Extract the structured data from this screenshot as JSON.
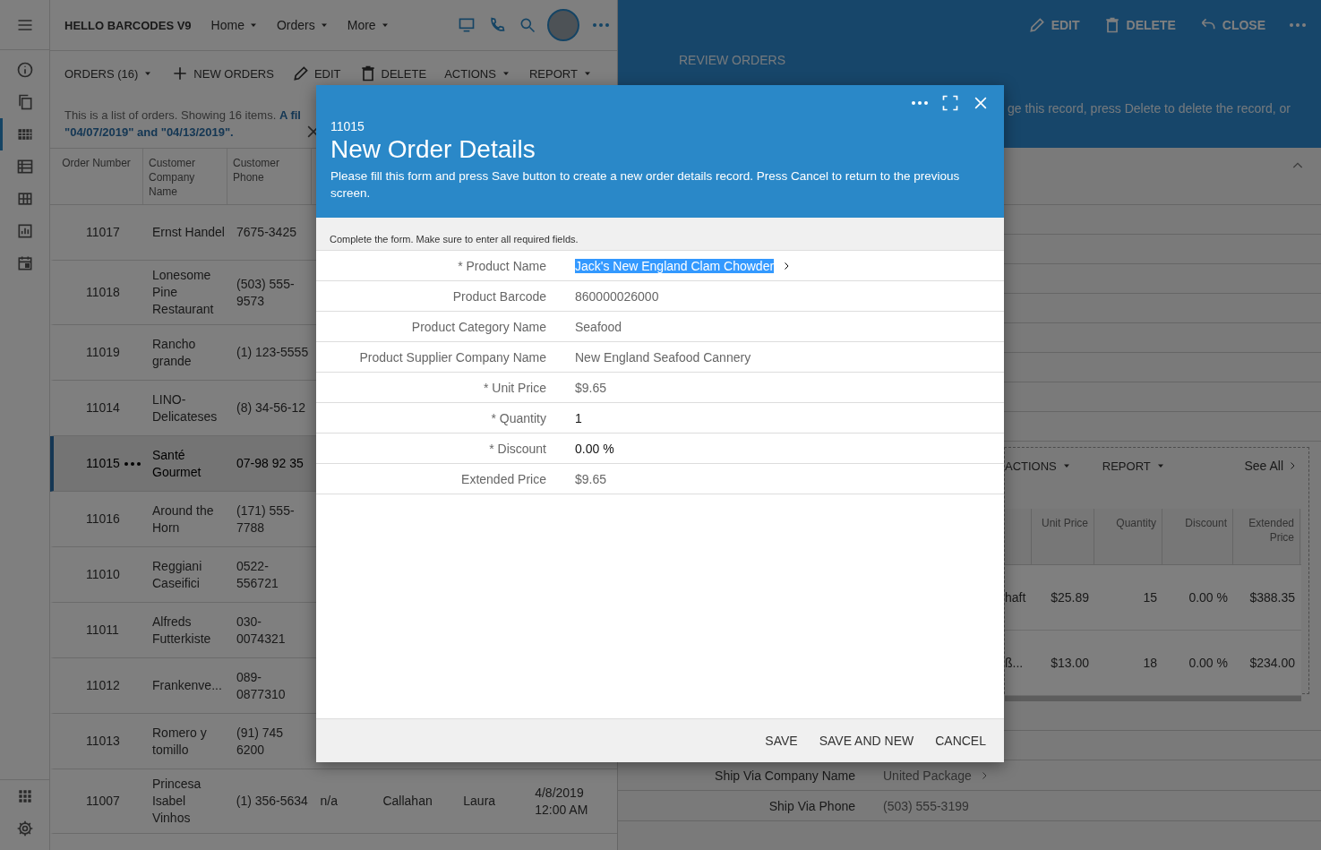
{
  "rail": {
    "top": [
      {
        "selected": false
      },
      {
        "selected": false
      },
      {
        "selected": true
      },
      {
        "selected": false
      },
      {
        "selected": false
      },
      {
        "selected": false
      },
      {
        "selected": false
      }
    ],
    "bottom": [
      {
        "selected": false
      },
      {
        "selected": false
      }
    ]
  },
  "app_bar": {
    "brand": "HELLO BARCODES V9",
    "menus": [
      "Home",
      "Orders",
      "More"
    ]
  },
  "list_toolbar": [
    {
      "kind": "dropdown",
      "label": "ORDERS (16)"
    },
    {
      "kind": "add",
      "label": "NEW ORDERS"
    },
    {
      "kind": "edit",
      "label": "EDIT"
    },
    {
      "kind": "delete",
      "label": "DELETE"
    },
    {
      "kind": "dropdown",
      "label": "ACTIONS"
    },
    {
      "kind": "dropdown",
      "label": "REPORT"
    }
  ],
  "filter": {
    "text": "This is a list of orders. Showing 16 items.",
    "link_start": "A fil",
    "link_end": "\"04/07/2019\" and \"04/13/2019\"."
  },
  "table": {
    "columns": [
      "Order Number",
      "Customer Company Name",
      "Customer Phone"
    ],
    "rows": [
      {
        "selected": false,
        "cells": [
          "11017",
          "Ernst Handel",
          "7675-3425"
        ]
      },
      {
        "selected": false,
        "cells": [
          "11018",
          "Lonesome Pine Restaurant",
          "(503) 555-9573"
        ]
      },
      {
        "selected": false,
        "cells": [
          "11019",
          "Rancho grande",
          "(1) 123-5555"
        ]
      },
      {
        "selected": false,
        "cells": [
          "11014",
          "LINO-Delicateses",
          "(8) 34-56-12"
        ]
      },
      {
        "selected": true,
        "cells": [
          "11015",
          "Santé Gourmet",
          "07-98 92 35"
        ]
      },
      {
        "selected": false,
        "cells": [
          "11016",
          "Around the Horn",
          "(171) 555-7788"
        ]
      },
      {
        "selected": false,
        "cells": [
          "11010",
          "Reggiani Caseifici",
          "0522-556721"
        ]
      },
      {
        "selected": false,
        "cells": [
          "11011",
          "Alfreds Futterkiste",
          "030-0074321"
        ]
      },
      {
        "selected": false,
        "cells": [
          "11012",
          "Frankenve...",
          "089-0877310"
        ]
      },
      {
        "selected": false,
        "cells": [
          "11013",
          "Romero y tomillo",
          "(91) 745 6200"
        ]
      },
      {
        "selected": false,
        "cells": [
          "11007",
          "Princesa Isabel Vinhos",
          "(1) 356-5634",
          "n/a",
          "Callahan",
          "Laura",
          "4/8/2019 12:00 AM"
        ]
      }
    ]
  },
  "review": {
    "toolbar": [
      "EDIT",
      "DELETE",
      "CLOSE"
    ],
    "title": "REVIEW ORDERS",
    "description": "ge this record, press Delete to delete the record, or",
    "details": {
      "toolbar": [
        "ACTIONS",
        "REPORT"
      ],
      "see_all": "See All",
      "columns": [
        "",
        "Unit Price",
        "Quantity",
        "Discount",
        "Extended Price"
      ],
      "rows": [
        [
          "haft",
          "$25.89",
          "15",
          "0.00 %",
          "$388.35"
        ],
        [
          "ß...",
          "$13.00",
          "18",
          "0.00 %",
          "$234.00"
        ]
      ]
    },
    "fields": [
      {
        "label": "Ship Via Company Name",
        "value": "United Package",
        "kind": "lookup"
      },
      {
        "label": "Ship Via Phone",
        "value": "(503) 555-3199",
        "kind": "readonly"
      }
    ]
  },
  "modal": {
    "record": "11015",
    "title": "New Order Details",
    "description": "Please fill this form and press Save button to create a new order details record. Press Cancel to return to the previous screen.",
    "hint": "Complete the form. Make sure to enter all required fields.",
    "fields": [
      {
        "label": "* Product Name",
        "value": "Jack's New England Clam Chowder",
        "kind": "lookup",
        "highlighted": true
      },
      {
        "label": "Product Barcode",
        "value": "860000026000",
        "kind": "readonly",
        "highlighted": false
      },
      {
        "label": "Product Category Name",
        "value": "Seafood",
        "kind": "readonly",
        "highlighted": false
      },
      {
        "label": "Product Supplier Company Name",
        "value": "New England Seafood Cannery",
        "kind": "readonly",
        "highlighted": false
      },
      {
        "label": "* Unit Price",
        "value": "$9.65",
        "kind": "readonly",
        "highlighted": false
      },
      {
        "label": "* Quantity",
        "value": "1",
        "kind": "input",
        "highlighted": false
      },
      {
        "label": "* Discount",
        "value": "0.00 %",
        "kind": "input",
        "highlighted": false
      },
      {
        "label": "Extended Price",
        "value": "$9.65",
        "kind": "readonly",
        "highlighted": false
      }
    ],
    "buttons": [
      "SAVE",
      "SAVE AND NEW",
      "CANCEL"
    ]
  }
}
